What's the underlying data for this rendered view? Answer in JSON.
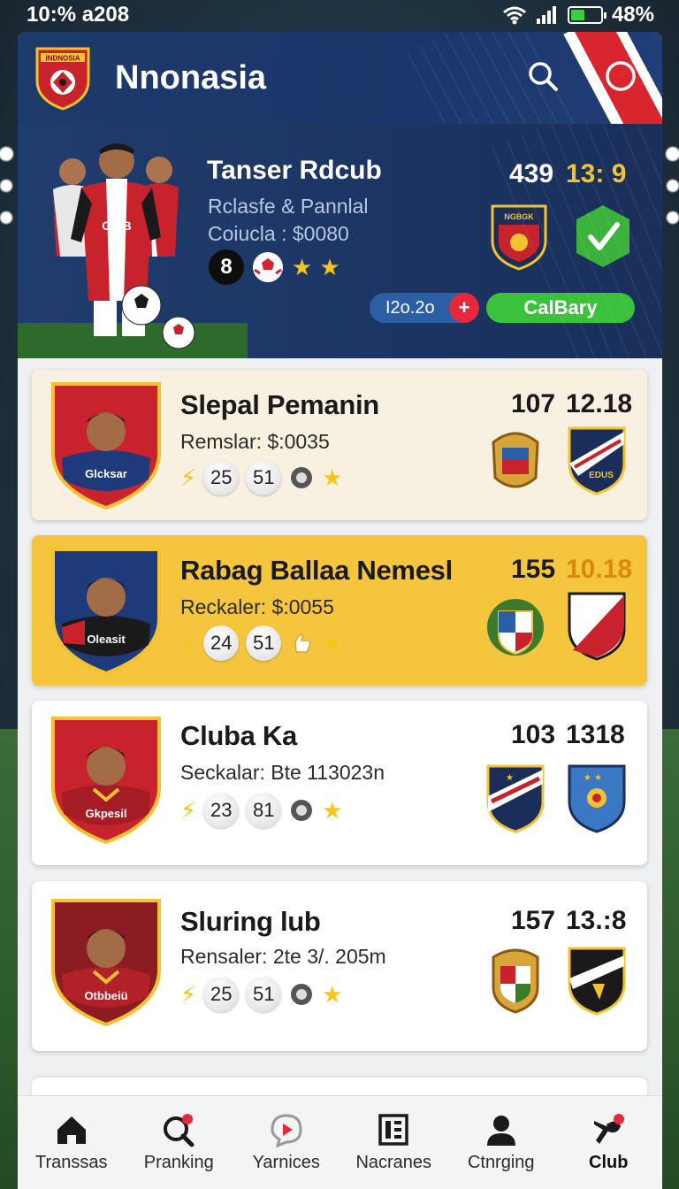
{
  "status_bar": {
    "time": "10:% a208",
    "battery": "48%",
    "battery_level": 0.48
  },
  "header": {
    "title": "Nnonasia",
    "logo_text": "INDNOSIA"
  },
  "hero": {
    "title": "Tanser Rdcub",
    "subtitle": "Rclasfe & Pannlal",
    "price": "Coiucla : $0080",
    "badge_number": "8",
    "stars": 2,
    "score": "439",
    "time": "13: 9",
    "crest_text": "NGBGK",
    "pill_code": "I2o.2o",
    "pill_plus": "+",
    "cta_label": "CalBary"
  },
  "clubs": [
    {
      "name": "Slepal Pemanin",
      "sub": "Remslar: $:0035",
      "stat1": "25",
      "stat2": "51",
      "num1": "107",
      "num2": "12.18",
      "jersey_text": "Glcksar",
      "crest_b_text": "EDUS"
    },
    {
      "name": "Rabag Ballaa Nemesl",
      "sub": "Reckaler: $:0055",
      "stat1": "24",
      "stat2": "51",
      "num1": "155",
      "num2": "10.18",
      "jersey_text": "Oleasit",
      "crest_b_text": ""
    },
    {
      "name": "Cluba Ka",
      "sub": "Seckalar: Bte 113023n",
      "stat1": "23",
      "stat2": "81",
      "num1": "103",
      "num2": "1318",
      "jersey_text": "Gkpesil",
      "crest_b_text": ""
    },
    {
      "name": "Sluring lub",
      "sub": "Rensaler: 2te 3/. 205m",
      "stat1": "25",
      "stat2": "51",
      "num1": "157",
      "num2": "13.:8",
      "jersey_text": "Otbbeiü",
      "crest_b_text": ""
    }
  ],
  "nav": {
    "items": [
      {
        "label": "Transsas",
        "icon": "home-icon"
      },
      {
        "label": "Pranking",
        "icon": "search-ball-icon"
      },
      {
        "label": "Yarnices",
        "icon": "play-bubble-icon"
      },
      {
        "label": "Nacranes",
        "icon": "news-icon"
      },
      {
        "label": "Ctnrging",
        "icon": "user-icon"
      },
      {
        "label": "Club",
        "icon": "whistle-icon"
      }
    ]
  },
  "colors": {
    "header_blue": "#1e3a6b",
    "accent_red": "#e5283a",
    "accent_green": "#3bc13b",
    "gold_card": "#f5c53e",
    "cream_card": "#f8f1e2",
    "star": "#f5c518"
  }
}
